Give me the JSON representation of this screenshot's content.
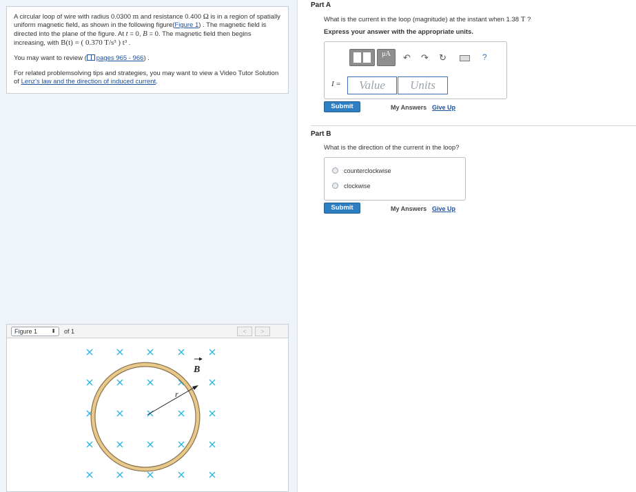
{
  "problem": {
    "p1_a": "A circular loop of wire with radius 0.0300 ",
    "p1_m": "m",
    "p1_b": " and resistance 0.400 ",
    "p1_ohm": "Ω",
    "p1_c": " is in a region of spatially uniform magnetic field, as shown in the following figure(",
    "p1_fig_link": "Figure 1",
    "p1_d": ") . The magnetic field is directed into the plane of the figure. At ",
    "p1_t": "t",
    "p1_e": " = 0, ",
    "p1_B": "B",
    "p1_f": " = 0. The magnetic field then begins increasing, with ",
    "p1_Bt": "B(t) = ( 0.370 T/s³ ) t³",
    "p1_g": " .",
    "review_a": "You may want to review (",
    "review_link": "pages 965 - 966",
    "review_b": ") .",
    "tips_a": "For related problemsolving tips and strategies, you may want to view a Video Tutor Solution of ",
    "tips_link": "Lenz's law and the direction of induced current",
    "tips_b": "."
  },
  "figure": {
    "select_label": "Figure 1",
    "of_label": "of 1",
    "prev": "<",
    "next": ">",
    "b_label": "B",
    "r_label": "r",
    "colors": {
      "cross": "#2bb6e3",
      "ring": "#e8c98a",
      "ring_edge": "#8a7350"
    }
  },
  "partA": {
    "title": "Part A",
    "question_a": "What is the current in the loop (magnitude) at the instant when 1.38 ",
    "question_T": "T",
    "question_b": " ?",
    "instruct": "Express your answer with the appropriate units.",
    "toolbar": {
      "mu": "μA",
      "help": "?"
    },
    "var_label": "I =",
    "value_placeholder": "Value",
    "units_placeholder": "Units",
    "submit": "Submit",
    "my_answers": "My Answers",
    "give_up": "Give Up"
  },
  "partB": {
    "title": "Part B",
    "question": "What is the direction of the current in the loop?",
    "choices": [
      "counterclockwise",
      "clockwise"
    ],
    "submit": "Submit",
    "my_answers": "My Answers",
    "give_up": "Give Up"
  },
  "colors": {
    "accent": "#2f7ec2",
    "link": "#1c4f9c"
  }
}
